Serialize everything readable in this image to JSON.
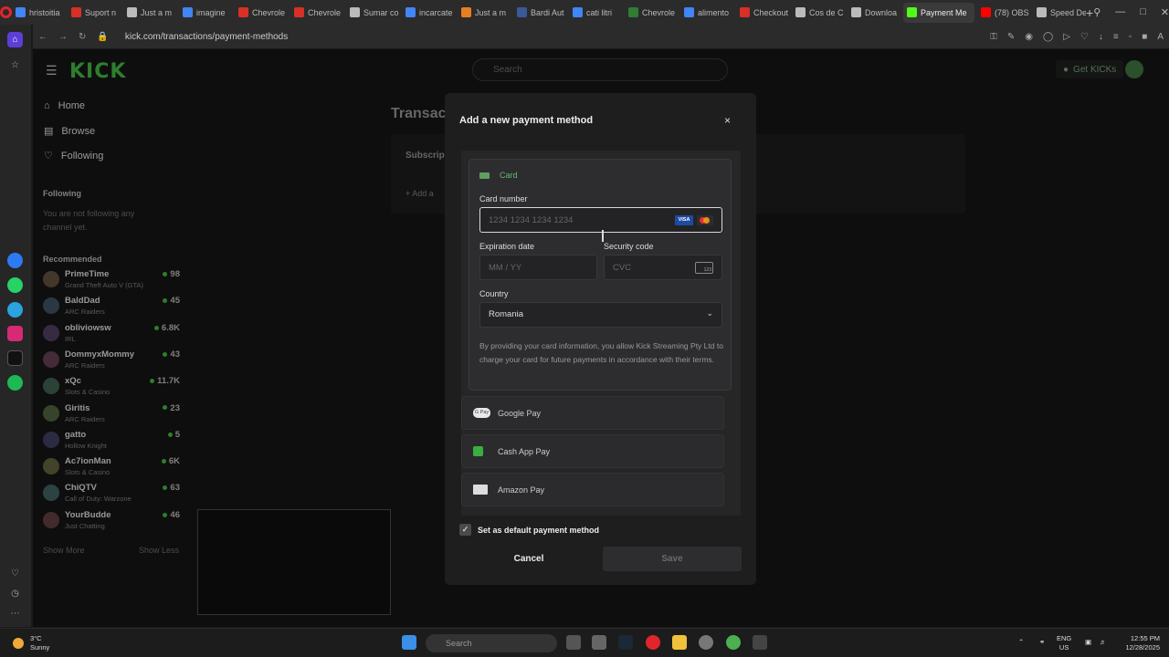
{
  "browser": {
    "tabs": [
      {
        "label": "hristoitia",
        "color": "#4285f4"
      },
      {
        "label": "Suport n",
        "color": "#d93025"
      },
      {
        "label": "Just a m",
        "color": "#bbbbbb"
      },
      {
        "label": "imagine",
        "color": "#4285f4"
      },
      {
        "label": "Chevrole",
        "color": "#d93025"
      },
      {
        "label": "Chevrole",
        "color": "#d93025"
      },
      {
        "label": "Sumar co",
        "color": "#bbbbbb"
      },
      {
        "label": "incarcate",
        "color": "#4285f4"
      },
      {
        "label": "Just a m",
        "color": "#e67e22"
      },
      {
        "label": "Bardi Aut",
        "color": "#3b5998"
      },
      {
        "label": "cati litri",
        "color": "#4285f4"
      },
      {
        "label": "Chevrole",
        "color": "#2e7d32"
      },
      {
        "label": "alimento",
        "color": "#4285f4"
      },
      {
        "label": "Checkout",
        "color": "#d93025"
      },
      {
        "label": "Cos de C",
        "color": "#bbbbbb"
      },
      {
        "label": "Downloa",
        "color": "#bbbbbb"
      },
      {
        "label": "Payment Me",
        "color": "#53fc18"
      },
      {
        "label": "(78) OBS",
        "color": "#ff0000"
      },
      {
        "label": "Speed De",
        "color": "#bbbbbb"
      }
    ],
    "new_tab": "+",
    "url": "kick.com/transactions/payment-methods"
  },
  "header": {
    "logo": "KICK",
    "search_placeholder": "Search",
    "get_kicks": "Get KICKs"
  },
  "sidebar": {
    "nav": [
      "Home",
      "Browse",
      "Following"
    ],
    "following_title": "Following",
    "following_empty": "You are not following any channel yet.",
    "recommended_title": "Recommended",
    "recommended": [
      {
        "name": "PrimeTime",
        "game": "Grand Theft Auto V (GTA)",
        "viewers": "98"
      },
      {
        "name": "BaldDad",
        "game": "ARC Raiders",
        "viewers": "45"
      },
      {
        "name": "obliviowsw",
        "game": "IRL",
        "viewers": "6.8K"
      },
      {
        "name": "DommyxMommy",
        "game": "ARC Raiders",
        "viewers": "43"
      },
      {
        "name": "xQc",
        "game": "Slots & Casino",
        "viewers": "11.7K"
      },
      {
        "name": "Giritis",
        "game": "ARC Raiders",
        "viewers": "23"
      },
      {
        "name": "gatto",
        "game": "Hollow Knight",
        "viewers": "5"
      },
      {
        "name": "Ac7ionMan",
        "game": "Slots & Casino",
        "viewers": "6K"
      },
      {
        "name": "ChiQTV",
        "game": "Call of Duty: Warzone",
        "viewers": "63"
      },
      {
        "name": "YourBudde",
        "game": "Just Chatting",
        "viewers": "46"
      }
    ],
    "show_more": "Show More",
    "show_less": "Show Less"
  },
  "page": {
    "title": "Transac",
    "subscriptions_label": "Subscrip",
    "add_label": "+ Add a"
  },
  "modal": {
    "title": "Add a new payment method",
    "close": "×",
    "card_label": "Card",
    "card_number_label": "Card number",
    "card_number_placeholder": "1234 1234 1234 1234",
    "visa": "VISA",
    "expiration_label": "Expiration date",
    "expiration_placeholder": "MM / YY",
    "security_label": "Security code",
    "security_placeholder": "CVC",
    "cvc_badge": "123",
    "country_label": "Country",
    "country_value": "Romania",
    "terms": "By providing your card information, you allow Kick Streaming Pty Ltd to charge your card for future payments in accordance with their terms.",
    "google_pay": "Google Pay",
    "google_pay_badge": "G Pay",
    "cash_app": "Cash App Pay",
    "amazon_pay": "Amazon Pay",
    "default_label": "Set as default payment method",
    "cancel": "Cancel",
    "save": "Save"
  },
  "taskbar": {
    "weather_temp": "3°C",
    "weather_desc": "Sunny",
    "search_placeholder": "Search",
    "lang_line1": "ENG",
    "lang_line2": "US",
    "time": "12:55 PM",
    "date": "12/28/2025"
  },
  "colors": {
    "accent": "#53fc18",
    "background": "#131313",
    "modal": "#1e1e1f"
  }
}
